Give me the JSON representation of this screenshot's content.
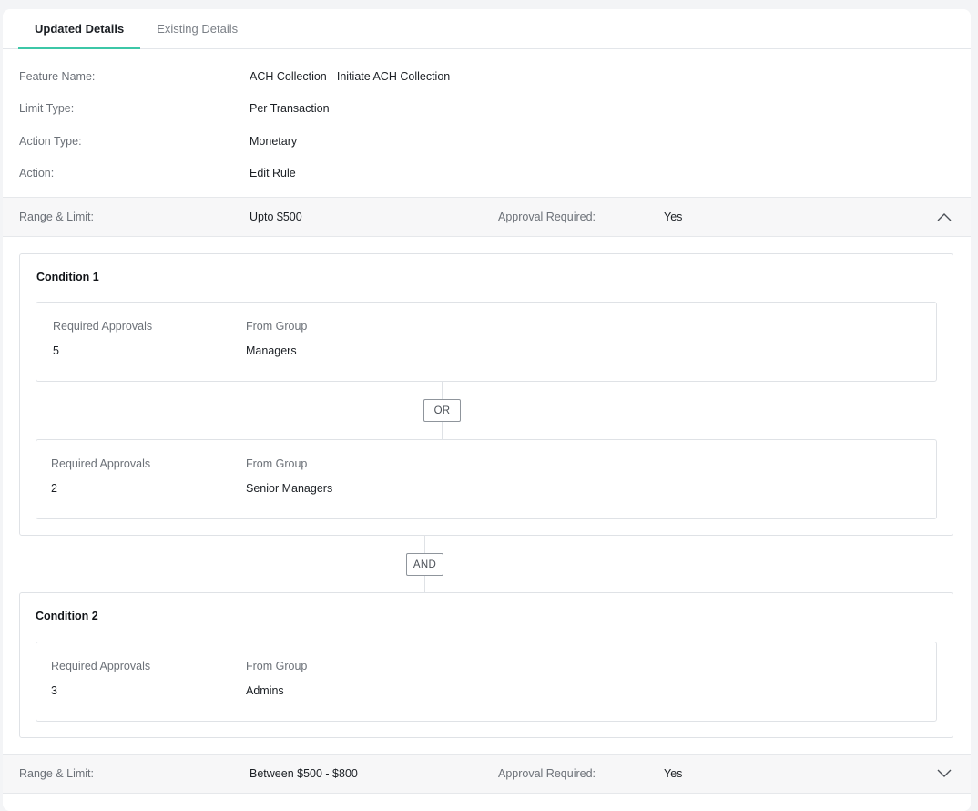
{
  "tabs": [
    {
      "label": "Updated Details",
      "active": true
    },
    {
      "label": "Existing Details",
      "active": false
    }
  ],
  "details": [
    {
      "label": "Feature Name:",
      "value": "ACH Collection - Initiate ACH Collection"
    },
    {
      "label": "Limit Type:",
      "value": "Per Transaction"
    },
    {
      "label": "Action Type:",
      "value": "Monetary"
    },
    {
      "label": "Action:",
      "value": "Edit Rule"
    }
  ],
  "ranges": [
    {
      "range_label": "Range & Limit:",
      "range_value": "Upto $500",
      "approval_label": "Approval Required:",
      "approval_value": "Yes",
      "expanded": true,
      "icon": "chevron-up-icon"
    },
    {
      "range_label": "Range & Limit:",
      "range_value": "Between $500 - $800",
      "approval_label": "Approval Required:",
      "approval_value": "Yes",
      "expanded": false,
      "icon": "chevron-down-icon"
    }
  ],
  "conditions": [
    {
      "title": "Condition 1",
      "groups": [
        {
          "approvals_header": "Required Approvals",
          "group_header": "From Group",
          "approvals": "5",
          "group": "Managers"
        },
        {
          "approvals_header": "Required Approvals",
          "group_header": "From Group",
          "approvals": "2",
          "group": "Senior Managers"
        }
      ],
      "inner_connector": "OR"
    },
    {
      "title": "Condition 2",
      "groups": [
        {
          "approvals_header": "Required Approvals",
          "group_header": "From Group",
          "approvals": "3",
          "group": "Admins"
        }
      ]
    }
  ],
  "condition_connector": "AND",
  "colors": {
    "accent": "#3cc7a7",
    "border": "#dfe2e6",
    "muted_text": "#6c7178"
  }
}
